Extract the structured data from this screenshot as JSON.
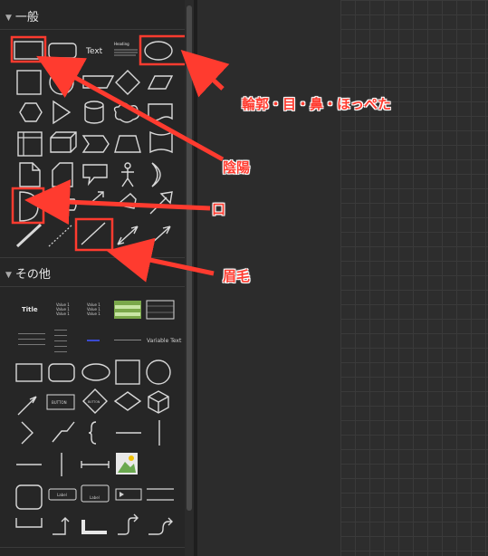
{
  "sections": [
    {
      "title": "一般"
    },
    {
      "title": "その他"
    }
  ],
  "general_texts": {
    "text_shape": "Text",
    "heading_shape": "Heading"
  },
  "other_texts": {
    "title_shape": "Title",
    "list_item": "Value 1",
    "variable_text": "Variable Text",
    "button_text1": "BUTTON",
    "button_text2": "BUTTON",
    "label1": "Label",
    "label2": "Label"
  },
  "annotations": [
    {
      "label": "輪郭・目・鼻・ほっぺた"
    },
    {
      "label": "陰陽"
    },
    {
      "label": "口"
    },
    {
      "label": "眉毛"
    }
  ],
  "colors": {
    "annotation": "#ff3b2f",
    "panel": "#262626",
    "canvas": "#2c2c2c"
  }
}
